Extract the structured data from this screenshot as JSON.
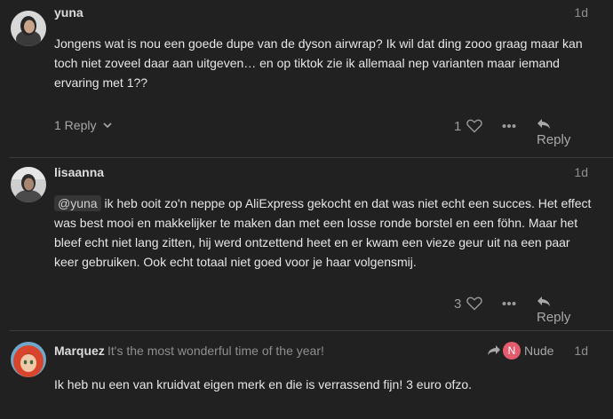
{
  "posts": [
    {
      "username": "yuna",
      "date": "1d",
      "body": "Jongens wat is nou een goede dupe van de dyson airwrap? Ik wil dat ding zooo graag maar kan toch niet zoveel daar aan uitgeven… en op tiktok zie ik allemaal nep varianten maar iemand ervaring met 1??",
      "replies_label": "1 Reply",
      "likes": "1",
      "reply_label": "Reply"
    },
    {
      "username": "lisaanna",
      "date": "1d",
      "mention": "@yuna",
      "body": " ik heb ooit zo'n neppe op AliExpress gekocht en dat was niet echt een succes. Het effect was best mooi en makkelijker te maken dan met een losse ronde borstel en een föhn. Maar het bleef echt niet lang zitten, hij werd ontzettend heet en er kwam een vieze geur uit na een paar keer gebruiken. Ook echt totaal niet goed voor je haar volgensmij.",
      "likes": "3",
      "reply_label": "Reply"
    },
    {
      "username": "Marquez",
      "user_title": "It's the most wonderful time of the year!",
      "reply_to_initial": "N",
      "reply_to_name": "Nude",
      "date": "1d",
      "body": "Ik heb nu een van kruidvat eigen merk en die is verrassend fijn! 3 euro ofzo."
    }
  ],
  "colors": {
    "background": "#212121",
    "badge": "#e45b6d"
  }
}
